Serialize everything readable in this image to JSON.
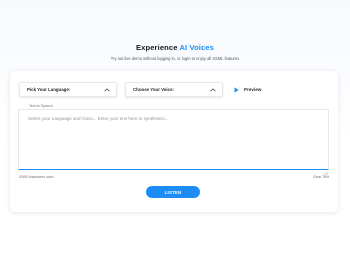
{
  "header": {
    "title_prefix": "Experience",
    "title_accent": "AI Voices",
    "subtitle": "Try out live demo without logging in, or login to enjoy all SSML features"
  },
  "controls": {
    "language_label": "Pick Your Language:",
    "voice_label": "Choose Your Voice:",
    "preview_label": "Preview"
  },
  "editor": {
    "label": "Text to Speech",
    "placeholder": "Select your Language and Voice... Enter your text here to synthesize...",
    "value": "",
    "char_count": "0/500 characters used",
    "clear_label": "Clear Text"
  },
  "actions": {
    "listen_label": "LISTEN"
  },
  "colors": {
    "accent": "#1d8df5",
    "text_dark": "#161b22",
    "muted": "#6b717a"
  },
  "icons": {
    "dropdown": "chevron-down-icon",
    "preview": "play-icon",
    "resize": "resize-grip-icon"
  }
}
